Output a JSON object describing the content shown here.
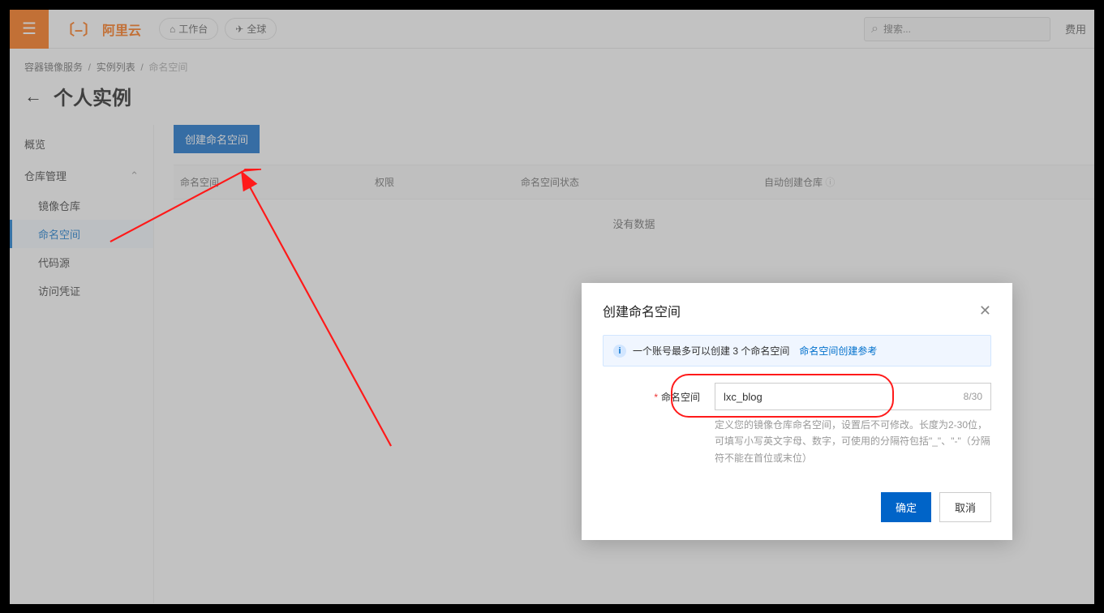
{
  "topbar": {
    "brand": "阿里云",
    "chip_workbench": "工作台",
    "chip_global": "全球",
    "search_placeholder": "搜索...",
    "fee": "费用"
  },
  "breadcrumb": {
    "a": "容器镜像服务",
    "b": "实例列表",
    "c": "命名空间"
  },
  "page_title": "个人实例",
  "sidebar": {
    "overview": "概览",
    "repo_mgmt": "仓库管理",
    "items": {
      "mirror_repo": "镜像仓库",
      "namespace": "命名空间",
      "code_source": "代码源",
      "access_cred": "访问凭证"
    }
  },
  "main": {
    "create_btn": "创建命名空间",
    "cols": {
      "c1": "命名空间",
      "c2": "权限",
      "c3": "命名空间状态",
      "c4": "自动创建仓库"
    },
    "nodata": "没有数据"
  },
  "modal": {
    "title": "创建命名空间",
    "info_prefix": "一个账号最多可以创建 3 个命名空间",
    "info_link": "命名空间创建参考",
    "label": "命名空间",
    "value": "lxc_blog",
    "count": "8/30",
    "hint": "定义您的镜像仓库命名空间，设置后不可修改。长度为2-30位，可填写小写英文字母、数字，可使用的分隔符包括\"_\"、\"-\"（分隔符不能在首位或末位）",
    "ok": "确定",
    "cancel": "取消"
  }
}
